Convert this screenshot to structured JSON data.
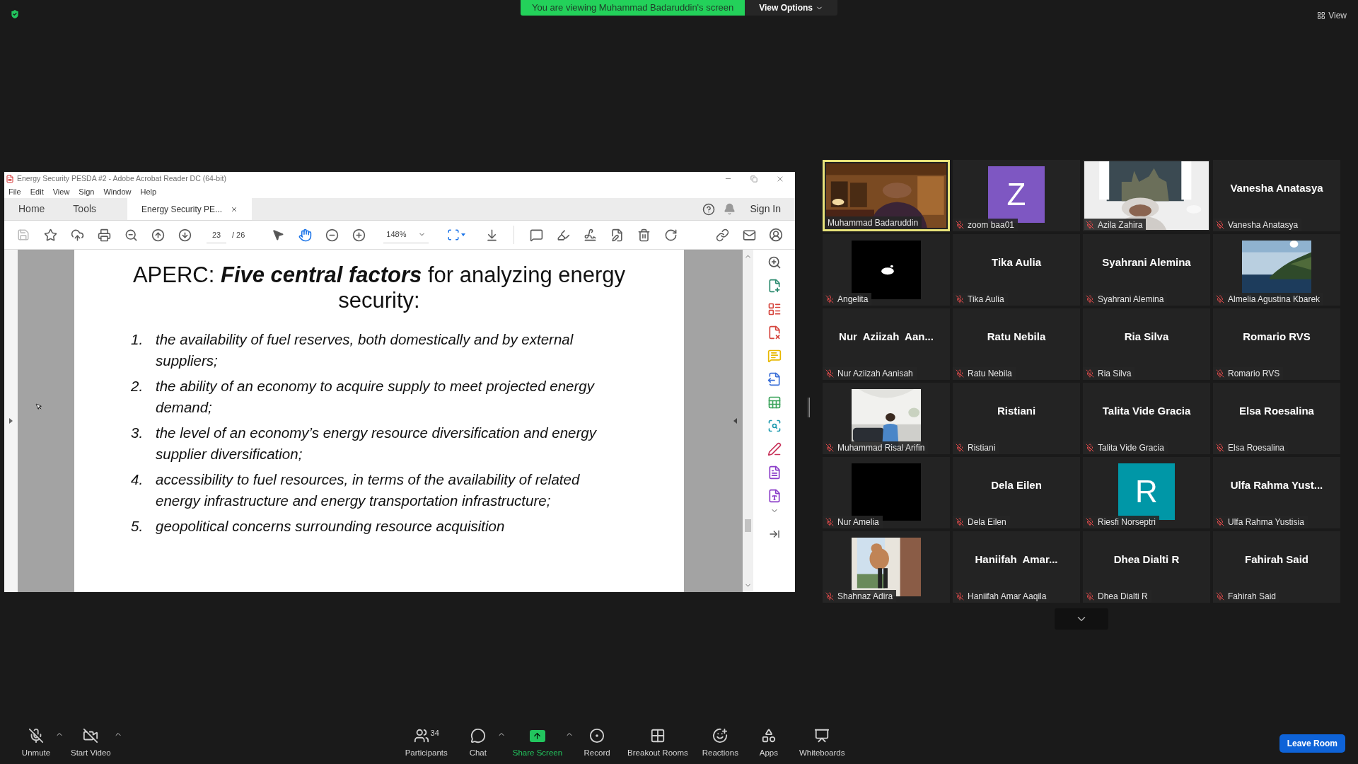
{
  "top_bar": {
    "banner": "You are viewing Muhammad Badaruddin's screen",
    "view_options": "View Options",
    "view_button": "View"
  },
  "acrobat": {
    "title": "Energy Security PESDA #2 - Adobe Acrobat Reader DC (64-bit)",
    "menu": [
      "File",
      "Edit",
      "View",
      "Sign",
      "Window",
      "Help"
    ],
    "tabs": [
      {
        "label": "Home",
        "selected": false,
        "kind": "nav"
      },
      {
        "label": "Tools",
        "selected": false,
        "kind": "nav"
      },
      {
        "label": "Energy Security PE...",
        "selected": true,
        "kind": "document"
      }
    ],
    "sign_in": "Sign In",
    "page_current": "23",
    "page_total": "/ 26",
    "zoom": "148%",
    "document": {
      "heading": "APERC: **Five central factors** for analyzing energy security:",
      "items": [
        {
          "number": "1.",
          "text": "the availability of fuel reserves, both domestically and by external suppliers;"
        },
        {
          "number": "2.",
          "text": "the ability of an economy to acquire supply to meet projected energy demand;"
        },
        {
          "number": "3.",
          "text": "the level of an economy’s energy resource diversification and energy supplier diversification;"
        },
        {
          "number": "4.",
          "text": "accessibility to fuel resources, in terms of the availability of related energy infrastructure and energy transportation infrastructure;"
        },
        {
          "number": "5.",
          "text": "geopolitical concerns surrounding resource acquisition"
        }
      ]
    }
  },
  "participants": [
    {
      "name": "Muhammad Badaruddin",
      "kind": "video",
      "muted": false,
      "speaking": true
    },
    {
      "name": "zoom baa01",
      "kind": "avatar",
      "letter": "Z",
      "color": "#7e57c2",
      "muted": true,
      "speaking": false
    },
    {
      "name": "Azila Zahira",
      "kind": "video",
      "muted": true,
      "speaking": false
    },
    {
      "name": "Vanesha Anatasya",
      "kind": "name",
      "display_name": "Vanesha Anatasya",
      "muted": true,
      "speaking": false
    },
    {
      "name": "Angelita",
      "kind": "inset",
      "muted": true,
      "speaking": false
    },
    {
      "name": "Tika Aulia",
      "kind": "name",
      "display_name": "Tika Aulia",
      "muted": true,
      "speaking": false
    },
    {
      "name": "Syahrani Alemina",
      "kind": "name",
      "display_name": "Syahrani Alemina",
      "muted": true,
      "speaking": false
    },
    {
      "name": "Almelia Agustina Kbarek",
      "kind": "inset",
      "muted": true,
      "speaking": false
    },
    {
      "name": "Nur Aziizah Aanisah",
      "kind": "name",
      "display_name": "Nur  Aziizah  Aan...",
      "muted": true,
      "speaking": false
    },
    {
      "name": "Ratu Nebila",
      "kind": "name",
      "display_name": "Ratu Nebila",
      "muted": true,
      "speaking": false
    },
    {
      "name": "Ria Silva",
      "kind": "name",
      "display_name": "Ria Silva",
      "muted": true,
      "speaking": false
    },
    {
      "name": "Romario RVS",
      "kind": "name",
      "display_name": "Romario RVS",
      "muted": true,
      "speaking": false
    },
    {
      "name": "Muhammad Risal Arifin",
      "kind": "inset",
      "muted": true,
      "speaking": false
    },
    {
      "name": "Ristiani",
      "kind": "name",
      "display_name": "Ristiani",
      "muted": true,
      "speaking": false
    },
    {
      "name": "Talita Vide Gracia",
      "kind": "name",
      "display_name": "Talita Vide Gracia",
      "muted": true,
      "speaking": false
    },
    {
      "name": "Elsa Roesalina",
      "kind": "name",
      "display_name": "Elsa Roesalina",
      "muted": true,
      "speaking": false
    },
    {
      "name": "Nur Amelia",
      "kind": "blank",
      "muted": true,
      "speaking": false
    },
    {
      "name": "Dela Eilen",
      "kind": "name",
      "display_name": "Dela Eilen",
      "muted": true,
      "speaking": false
    },
    {
      "name": "Riesfi Norseptri",
      "kind": "avatar",
      "letter": "R",
      "color": "#0097a7",
      "muted": true,
      "speaking": false
    },
    {
      "name": "Ulfa Rahma Yustisia",
      "kind": "name",
      "display_name": "Ulfa Rahma Yust...",
      "muted": true,
      "speaking": false
    },
    {
      "name": "Shahnaz Adira",
      "kind": "inset",
      "muted": true,
      "speaking": false
    },
    {
      "name": "Haniifah Amar Aaqila",
      "kind": "name",
      "display_name": "Haniifah  Amar...",
      "muted": true,
      "speaking": false
    },
    {
      "name": "Dhea Dialti R",
      "kind": "name",
      "display_name": "Dhea Dialti R",
      "muted": true,
      "speaking": false
    },
    {
      "name": "Fahirah Said",
      "kind": "name",
      "display_name": "Fahirah Said",
      "muted": true,
      "speaking": false
    }
  ],
  "controls": [
    {
      "label": "Unmute",
      "kind": "mic",
      "menu": true
    },
    {
      "label": "Start Video",
      "kind": "video",
      "menu": true
    },
    {
      "label": "Participants",
      "kind": "participants",
      "count": "34",
      "menu": false
    },
    {
      "label": "Chat",
      "kind": "chat",
      "menu": true
    },
    {
      "label": "Share Screen",
      "kind": "share",
      "menu": true
    },
    {
      "label": "Record",
      "kind": "record",
      "menu": false
    },
    {
      "label": "Breakout Rooms",
      "kind": "breakout",
      "menu": false
    },
    {
      "label": "Reactions",
      "kind": "reactions",
      "menu": false
    },
    {
      "label": "Apps",
      "kind": "apps",
      "menu": false
    },
    {
      "label": "Whiteboards",
      "kind": "whiteboard",
      "menu": false
    }
  ],
  "leave": "Leave Room"
}
